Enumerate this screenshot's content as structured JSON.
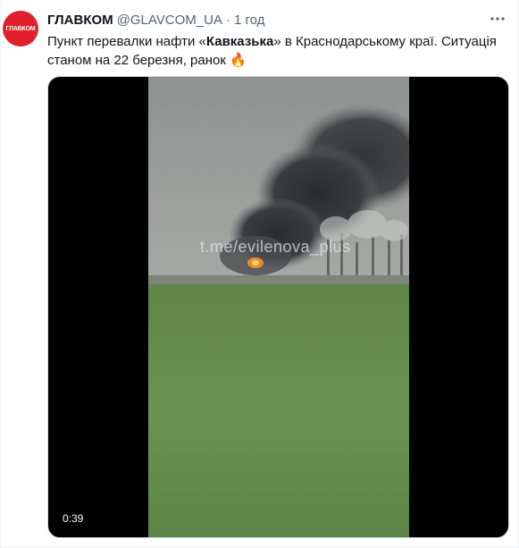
{
  "tweet": {
    "avatar_text": "ГЛАВКОМ",
    "author_name": "ГЛАВКОМ",
    "handle": "@GLAVCOM_UA",
    "separator": "·",
    "time": "1 год",
    "text_part1": "Пункт перевалки нафти «",
    "text_bold": "Кавказька",
    "text_part2": "» в Краснодарському краї. Ситуація станом на 22 березня, ранок ",
    "emoji": "🔥"
  },
  "video": {
    "duration": "0:39",
    "watermark": "t.me/evilenova_plus"
  },
  "colors": {
    "brand": "#e0202a",
    "text": "#0f1419",
    "secondary": "#536471"
  }
}
